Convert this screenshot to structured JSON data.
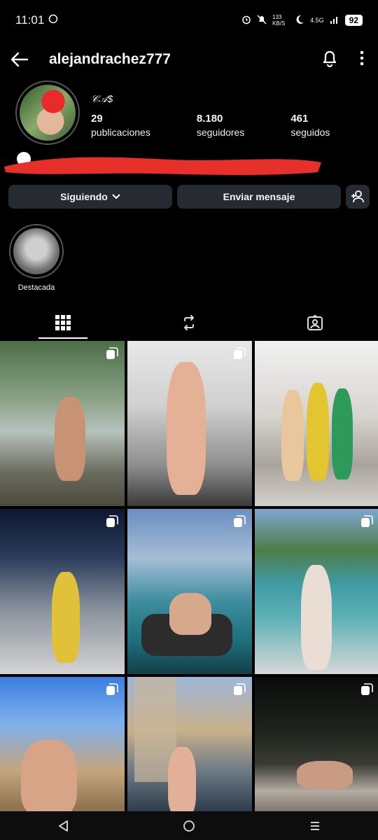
{
  "status": {
    "time": "11:01",
    "net_speed": "133 KB/S",
    "signal": "4.5G",
    "battery": "92"
  },
  "header": {
    "username": "alejandrachez777"
  },
  "profile": {
    "bio_name": "𝒞𝒜$",
    "stats": [
      {
        "value": "29",
        "label": "publicaciones"
      },
      {
        "value": "8.180",
        "label": "seguidores"
      },
      {
        "value": "461",
        "label": "seguidos"
      }
    ]
  },
  "actions": {
    "following_label": "Siguiendo",
    "message_label": "Enviar mensaje"
  },
  "highlights": [
    {
      "label": "Destacada"
    }
  ],
  "colors": {
    "background": "#000000",
    "button_bg": "#262a31",
    "redaction": "#e8302a"
  },
  "icons": {
    "back": "arrow-left-icon",
    "notifications": "bell-icon",
    "more": "more-vertical-icon",
    "add_user": "add-person-icon",
    "grid_tab": "grid-icon",
    "reels_tab": "repost-icon",
    "tagged_tab": "tagged-icon",
    "multi_post": "carousel-icon"
  }
}
